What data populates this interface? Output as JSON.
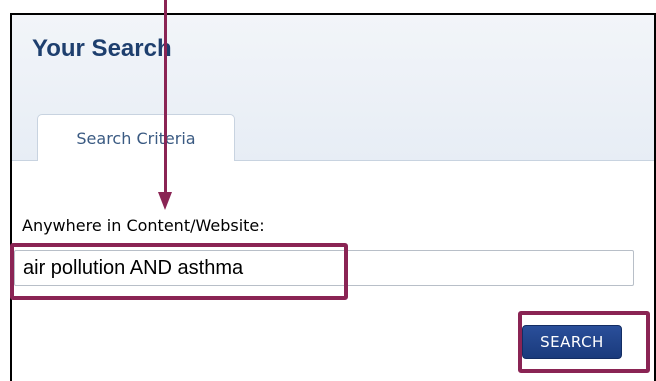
{
  "header": {
    "title": "Your Search"
  },
  "tabs": [
    {
      "label": "Search Criteria"
    }
  ],
  "form": {
    "field_label": "Anywhere in Content/Website:",
    "search_value": "air pollution AND asthma",
    "search_button_label": "SEARCH"
  },
  "colors": {
    "accent": "#8a2454",
    "title": "#1e3f6e",
    "button": "#1a3a7c"
  }
}
